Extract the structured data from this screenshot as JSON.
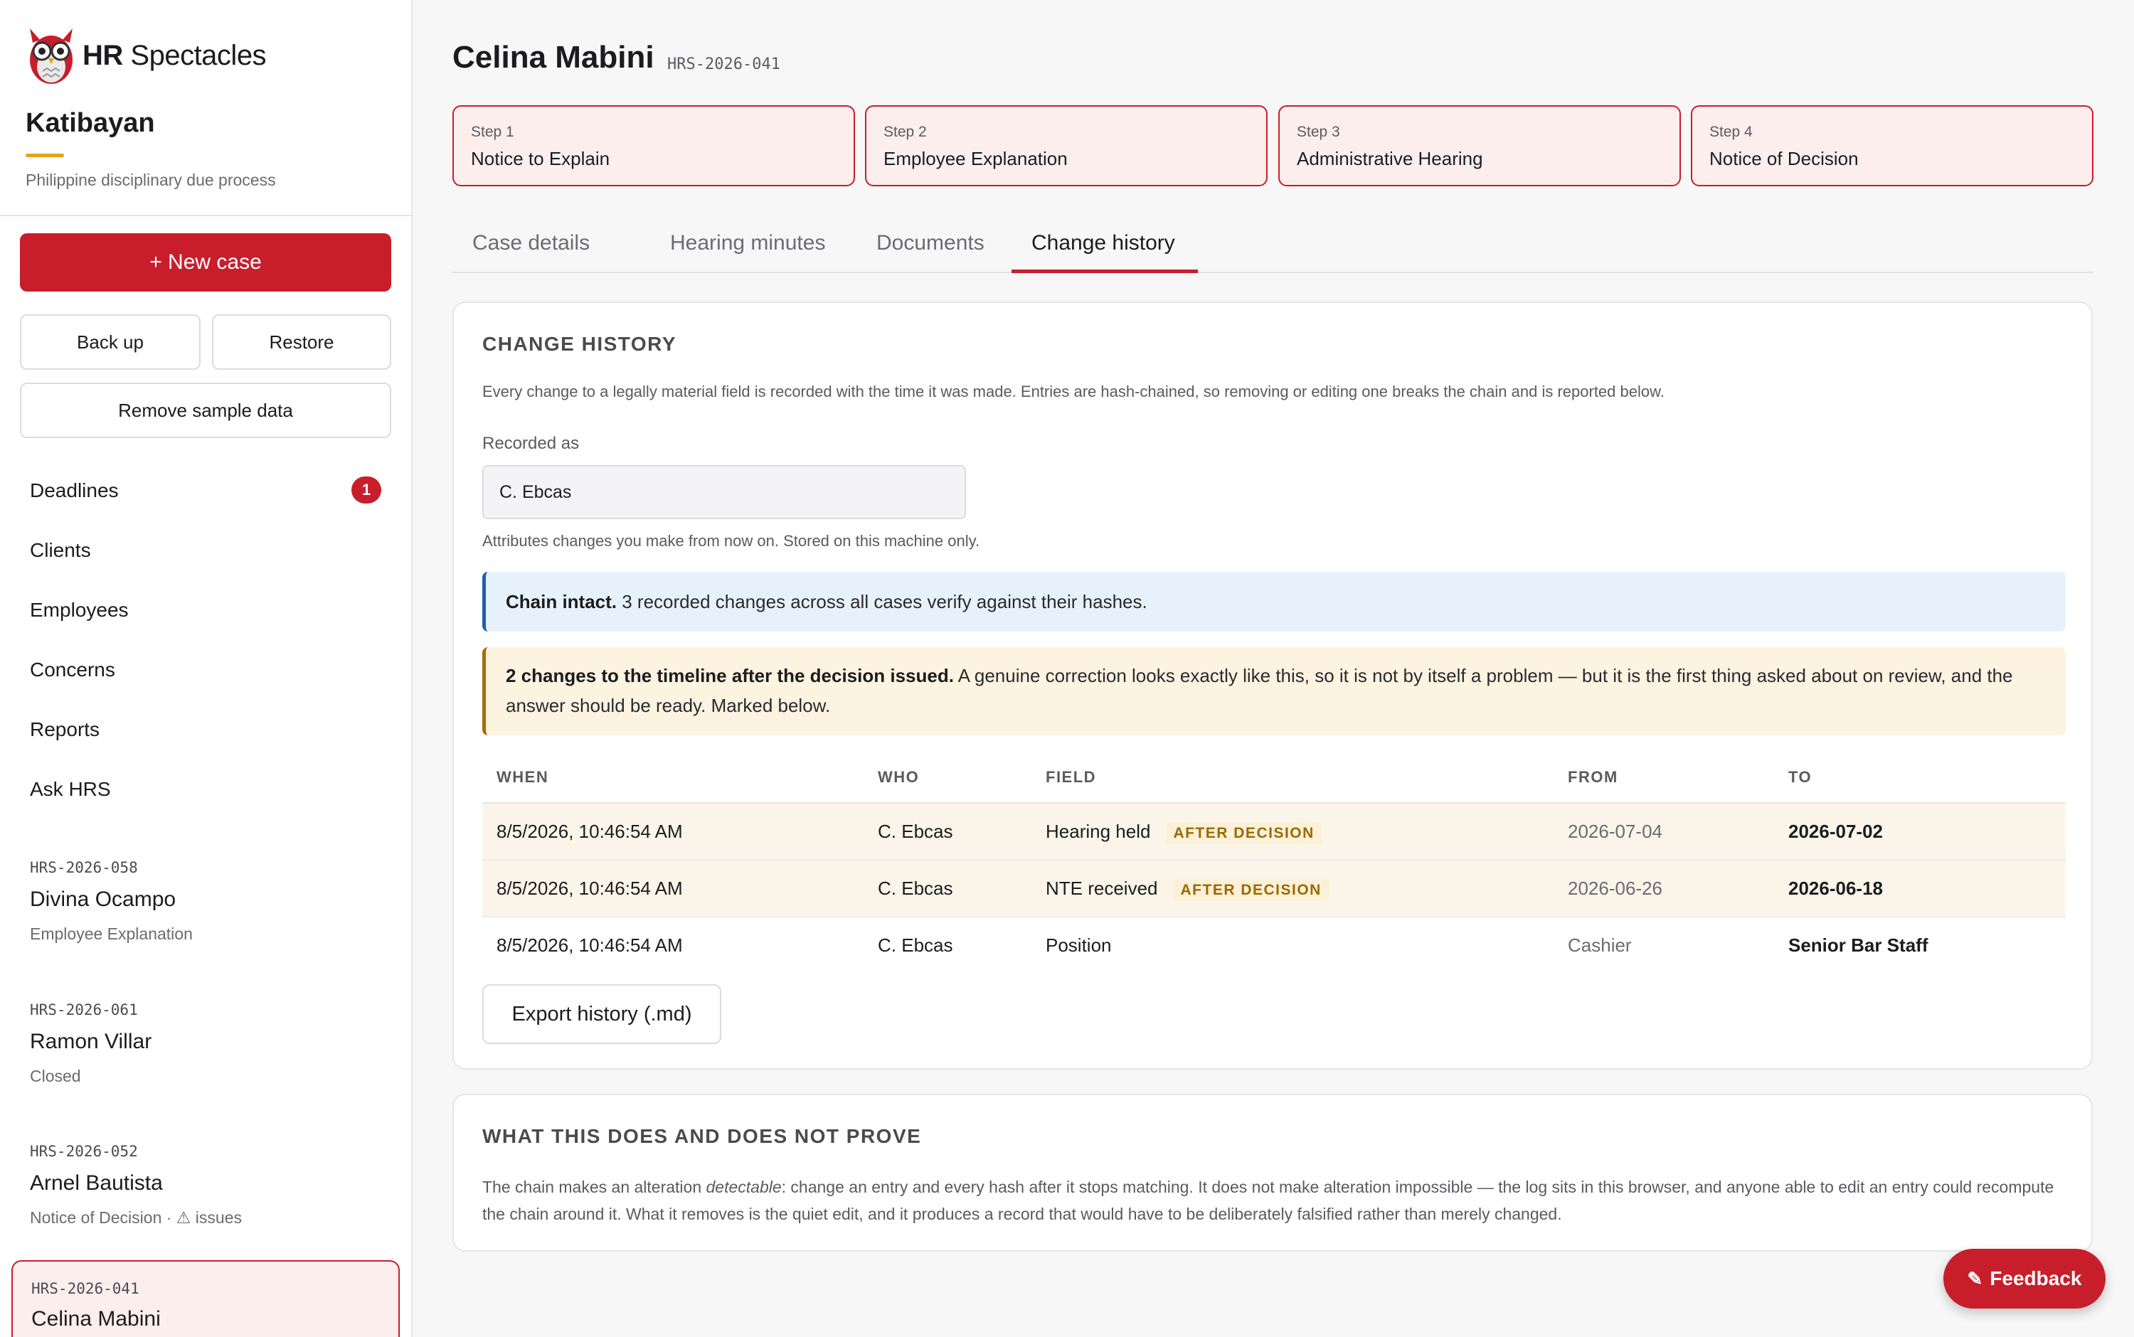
{
  "brand": {
    "strong": "HR",
    "rest": " Spectacles"
  },
  "org": {
    "name": "Katibayan",
    "subtitle": "Philippine disciplinary due process"
  },
  "sidebar": {
    "new_case_label": "+ New case",
    "backup_label": "Back up",
    "restore_label": "Restore",
    "remove_sample_label": "Remove sample data",
    "nav": [
      {
        "label": "Deadlines",
        "badge": "1"
      },
      {
        "label": "Clients"
      },
      {
        "label": "Employees"
      },
      {
        "label": "Concerns"
      },
      {
        "label": "Reports"
      },
      {
        "label": "Ask HRS"
      }
    ],
    "cases": [
      {
        "id": "HRS-2026-058",
        "name": "Divina Ocampo",
        "status": "Employee Explanation"
      },
      {
        "id": "HRS-2026-061",
        "name": "Ramon Villar",
        "status": "Closed"
      },
      {
        "id": "HRS-2026-052",
        "name": "Arnel Bautista",
        "status": "Notice of Decision · ⚠ issues"
      },
      {
        "id": "HRS-2026-041",
        "name": "Celina Mabini",
        "status": ""
      }
    ]
  },
  "case": {
    "title": "Celina Mabini",
    "code": "HRS-2026-041"
  },
  "steps": [
    {
      "num": "Step 1",
      "label": "Notice to Explain"
    },
    {
      "num": "Step 2",
      "label": "Employee Explanation"
    },
    {
      "num": "Step 3",
      "label": "Administrative Hearing"
    },
    {
      "num": "Step 4",
      "label": "Notice of Decision"
    }
  ],
  "tabs": [
    "Case details",
    "Hearing minutes",
    "Documents",
    "Change history"
  ],
  "history": {
    "title": "Change history",
    "description": "Every change to a legally material field is recorded with the time it was made. Entries are hash-chained, so removing or editing one breaks the chain and is reported below.",
    "recorded_as_label": "Recorded as",
    "recorded_as_value": "C. Ebcas",
    "recorded_as_hint": "Attributes changes you make from now on. Stored on this machine only.",
    "info_bold": "Chain intact.",
    "info_text": " 3 recorded changes across all cases verify against their hashes.",
    "warn_bold": "2 changes to the timeline after the decision issued.",
    "warn_text": " A genuine correction looks exactly like this, so it is not by itself a problem — but it is the first thing asked about on review, and the answer should be ready. Marked below.",
    "columns": [
      "When",
      "Who",
      "Field",
      "From",
      "To"
    ],
    "rows": [
      {
        "when": "8/5/2026, 10:46:54 AM",
        "who": "C. Ebcas",
        "field": "Hearing held",
        "flag": "After decision",
        "from": "2026-07-04",
        "to": "2026-07-02"
      },
      {
        "when": "8/5/2026, 10:46:54 AM",
        "who": "C. Ebcas",
        "field": "NTE received",
        "flag": "After decision",
        "from": "2026-06-26",
        "to": "2026-06-18"
      },
      {
        "when": "8/5/2026, 10:46:54 AM",
        "who": "C. Ebcas",
        "field": "Position",
        "flag": "",
        "from": "Cashier",
        "to": "Senior Bar Staff"
      }
    ],
    "export_label": "Export history (.md)"
  },
  "proof": {
    "title": "What this does and does not prove",
    "text_before": "The chain makes an alteration ",
    "text_em": "detectable",
    "text_after": ": change an entry and every hash after it stops matching. It does not make alteration impossible — the log sits in this browser, and anyone able to edit an entry could recompute the chain around it. What it removes is the quiet edit, and it produces a record that would have to be deliberately falsified rather than merely changed."
  },
  "feedback_label": "Feedback",
  "colors": {
    "accent": "#c81e2b",
    "brand_gold": "#e7a21a",
    "info": "#1f5fa8",
    "warn": "#a66d00"
  },
  "icons": {
    "logo": "owl-spectacles-logo",
    "feedback": "pencil-icon"
  }
}
